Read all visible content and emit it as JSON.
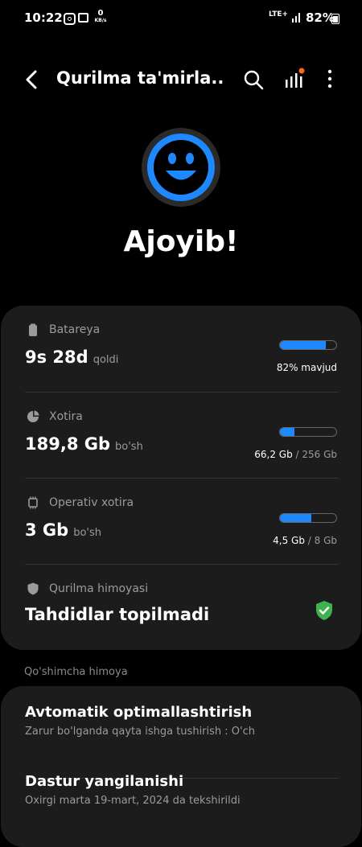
{
  "status_bar": {
    "time": "10:22",
    "net_speed_value": "0",
    "net_speed_unit": "KB/s",
    "network": "LTE+",
    "battery_percent": "82%"
  },
  "app_bar": {
    "title": "Qurilma ta'mirla..."
  },
  "status": {
    "headline": "Ajoyib!",
    "accent_color": "#1e88ff"
  },
  "battery": {
    "label": "Batareya",
    "value": "9s 28d",
    "unit": "qoldi",
    "fill_percent": 82,
    "right_text": "82% mavjud"
  },
  "storage": {
    "label": "Xotira",
    "value": "189,8 Gb",
    "unit": "bo'sh",
    "fill_percent": 26,
    "used": "66,2 Gb",
    "separator": " / ",
    "total": "256 Gb"
  },
  "ram": {
    "label": "Operativ xotira",
    "value": "3 Gb",
    "unit": "bo'sh",
    "fill_percent": 56,
    "used": "4,5 Gb",
    "separator": " / ",
    "total": "8 Gb"
  },
  "protection": {
    "label": "Qurilma himoyasi",
    "status_text": "Tahdidlar topilmadi",
    "status_color": "#3db24f"
  },
  "extra_section": {
    "header": "Qo'shimcha himoya",
    "items": [
      {
        "title": "Avtomatik optimallashtirish",
        "subtitle": "Zarur bo'lganda qayta ishga tushirish : O'ch"
      },
      {
        "title": "Dastur yangilanishi",
        "subtitle": "Oxirgi marta 19-mart, 2024 da tekshirildi"
      }
    ]
  }
}
